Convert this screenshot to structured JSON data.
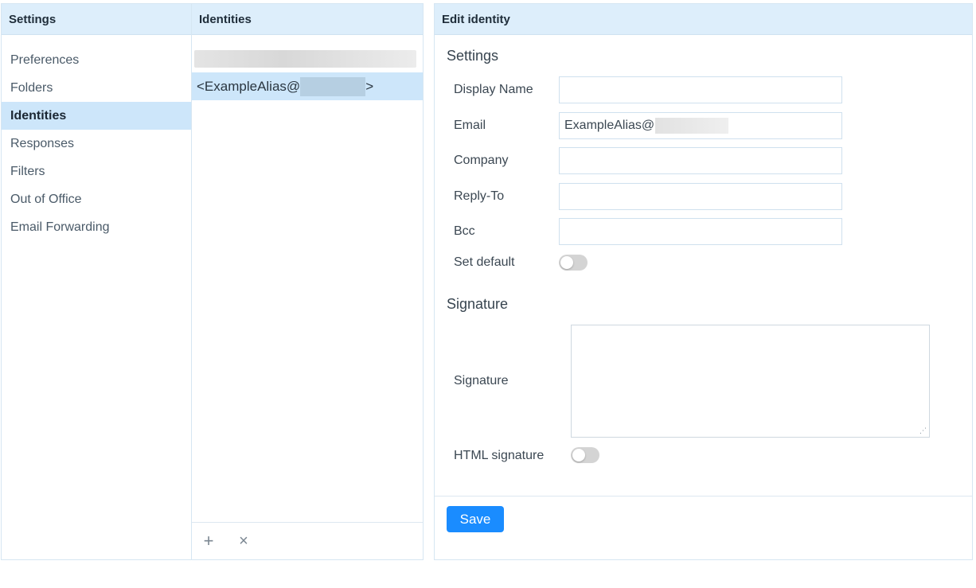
{
  "settings": {
    "header": "Settings",
    "menu": [
      {
        "label": "Preferences"
      },
      {
        "label": "Folders"
      },
      {
        "label": "Identities",
        "active": true
      },
      {
        "label": "Responses"
      },
      {
        "label": "Filters"
      },
      {
        "label": "Out of Office"
      },
      {
        "label": "Email Forwarding"
      }
    ]
  },
  "identities": {
    "header": "Identities",
    "selected_prefix": "<ExampleAlias@",
    "selected_suffix": ">",
    "add_icon": "plus-icon",
    "delete_icon": "close-icon",
    "add_glyph": "+",
    "delete_glyph": "×"
  },
  "edit": {
    "header": "Edit identity",
    "settings_title": "Settings",
    "fields": {
      "display_name_label": "Display Name",
      "display_name_value": "",
      "email_label": "Email",
      "email_value": "ExampleAlias@",
      "company_label": "Company",
      "company_value": "",
      "reply_to_label": "Reply-To",
      "reply_to_value": "",
      "bcc_label": "Bcc",
      "bcc_value": "",
      "set_default_label": "Set default",
      "set_default_on": false
    },
    "signature_title": "Signature",
    "signature_label": "Signature",
    "signature_value": "",
    "html_signature_label": "HTML signature",
    "html_signature_on": false,
    "save_label": "Save"
  },
  "colors": {
    "header_bg": "#ddeefb",
    "active_bg": "#cde6fa",
    "save_button": "#1a8cff",
    "toggle_off": "#d4d4d4"
  }
}
